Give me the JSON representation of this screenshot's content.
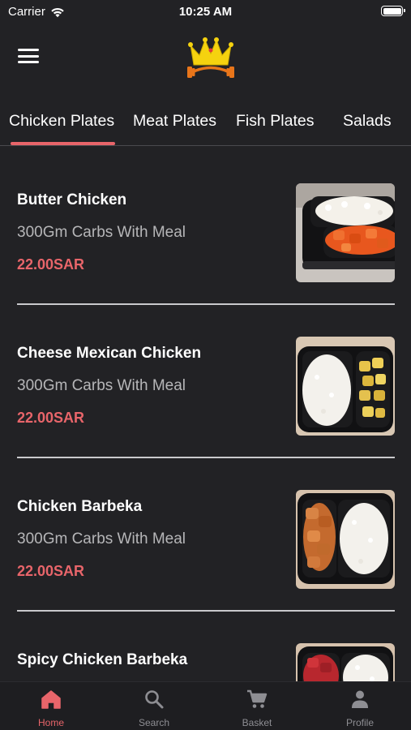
{
  "status_bar": {
    "carrier": "Carrier",
    "time": "10:25 AM"
  },
  "header": {
    "logo_icon": "crown-barbell-logo",
    "menu_icon": "hamburger-menu-icon"
  },
  "categories": {
    "tabs": [
      {
        "label": "Chicken Plates",
        "selected": true
      },
      {
        "label": "Meat Plates",
        "selected": false
      },
      {
        "label": "Fish Plates",
        "selected": false
      },
      {
        "label": "Salads",
        "selected": false
      }
    ],
    "accent_color": "#e8656a"
  },
  "menu": {
    "items": [
      {
        "name": "Butter Chicken",
        "description": "300Gm Carbs With Meal",
        "price": "22.00SAR"
      },
      {
        "name": "Cheese Mexican Chicken",
        "description": "300Gm Carbs With Meal",
        "price": "22.00SAR"
      },
      {
        "name": "Chicken Barbeka",
        "description": "300Gm Carbs With Meal",
        "price": "22.00SAR"
      },
      {
        "name": "Spicy Chicken Barbeka",
        "description": "",
        "price": ""
      }
    ]
  },
  "tab_bar": {
    "items": [
      {
        "label": "Home",
        "icon": "home-icon",
        "active": true
      },
      {
        "label": "Search",
        "icon": "search-icon",
        "active": false
      },
      {
        "label": "Basket",
        "icon": "cart-icon",
        "active": false
      },
      {
        "label": "Profile",
        "icon": "person-icon",
        "active": false
      }
    ]
  }
}
